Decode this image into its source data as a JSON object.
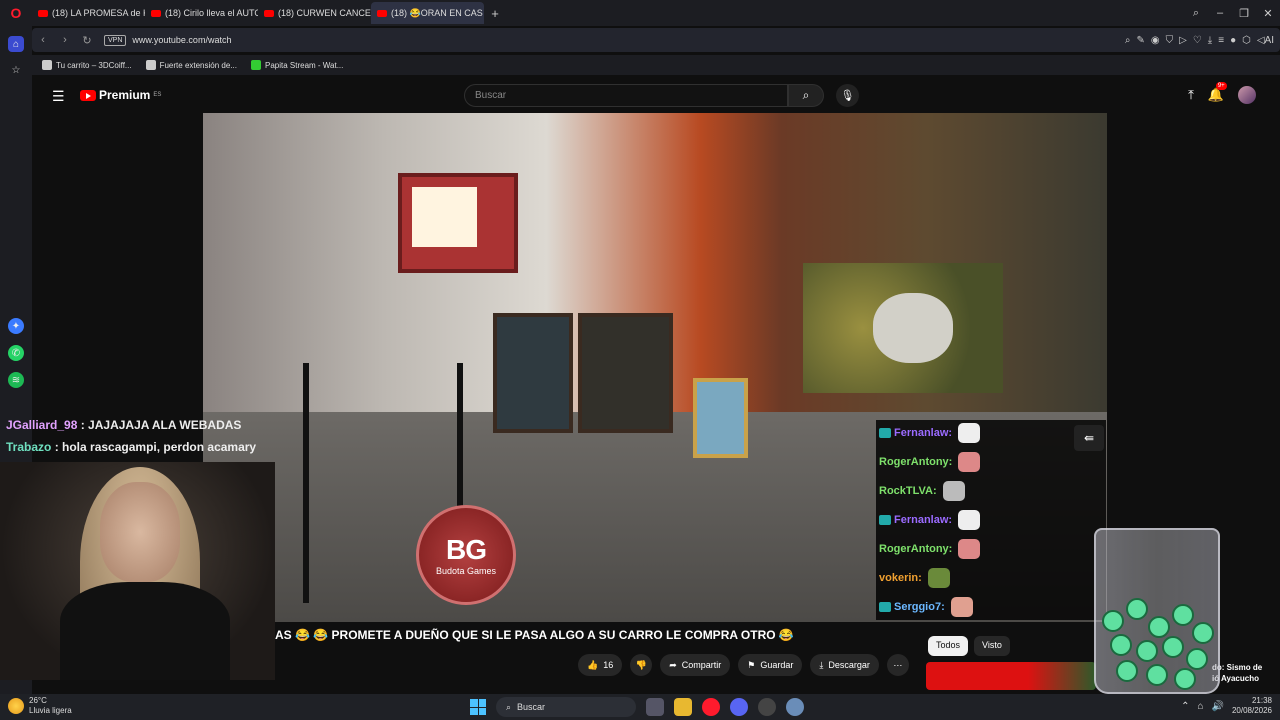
{
  "browser": {
    "tabs": [
      {
        "label": "(18) LA PROMESA de King"
      },
      {
        "label": "(18) Cirilo lleva el AUTO p"
      },
      {
        "label": "(18) CURWEN CANCELA L"
      },
      {
        "label": "(18) 😂ORAN EN CAS"
      }
    ],
    "url": "www.youtube.com/watch",
    "vpn_label": "VPN",
    "ai_label": "AI",
    "bookmarks": [
      {
        "label": "Tu carrito – 3DCoiff..."
      },
      {
        "label": "Fuerte extensión de..."
      },
      {
        "label": "Papita Stream - Wat..."
      }
    ]
  },
  "youtube": {
    "logo_text": "Premium",
    "region": "ES",
    "search_placeholder": "Buscar",
    "notif_count": "9+"
  },
  "overlay": {
    "bg_logo_letters": "BG",
    "bg_logo_name": "Budota Games",
    "chat_left": [
      {
        "user": "JGalliard_98",
        "text": " : JAJAJAJA ALA WEBADAS",
        "color": "#e2a3ff"
      },
      {
        "user": "Trabazo",
        "text": " : hola rascagampi, perdon acamary",
        "color": "#6fe0c0"
      }
    ],
    "chat_right": [
      {
        "user": "Fernanlaw:",
        "color": "#9b6bff",
        "badge": true
      },
      {
        "user": "RogerAntony:",
        "color": "#7ee06b",
        "badge": false
      },
      {
        "user": "RockTLVA:",
        "color": "#7ee06b",
        "badge": false
      },
      {
        "user": "Fernanlaw:",
        "color": "#9b6bff",
        "badge": true
      },
      {
        "user": "RogerAntony:",
        "color": "#7ee06b",
        "badge": false
      },
      {
        "user": "vokerin:",
        "color": "#f0a030",
        "badge": false
      },
      {
        "user": "Serggio7:",
        "color": "#6bb8ff",
        "badge": true
      }
    ],
    "ticker": "AS 😂 😂 PROMETE A DUEÑO QUE SI LE PASA ALGO A SU CARRO LE COMPRA OTRO 😂"
  },
  "actions": {
    "like_count": "16",
    "share": "Compartir",
    "save": "Guardar",
    "download": "Descargar"
  },
  "recommendations": {
    "chips": [
      "Todos",
      "Visto"
    ],
    "next_title": "do: Sismo de\nió Ayacucho"
  },
  "taskbar": {
    "temperature": "26°C",
    "weather": "Lluvia ligera",
    "search_placeholder": "Buscar",
    "time": "21:38",
    "date": "20/08/2026"
  }
}
